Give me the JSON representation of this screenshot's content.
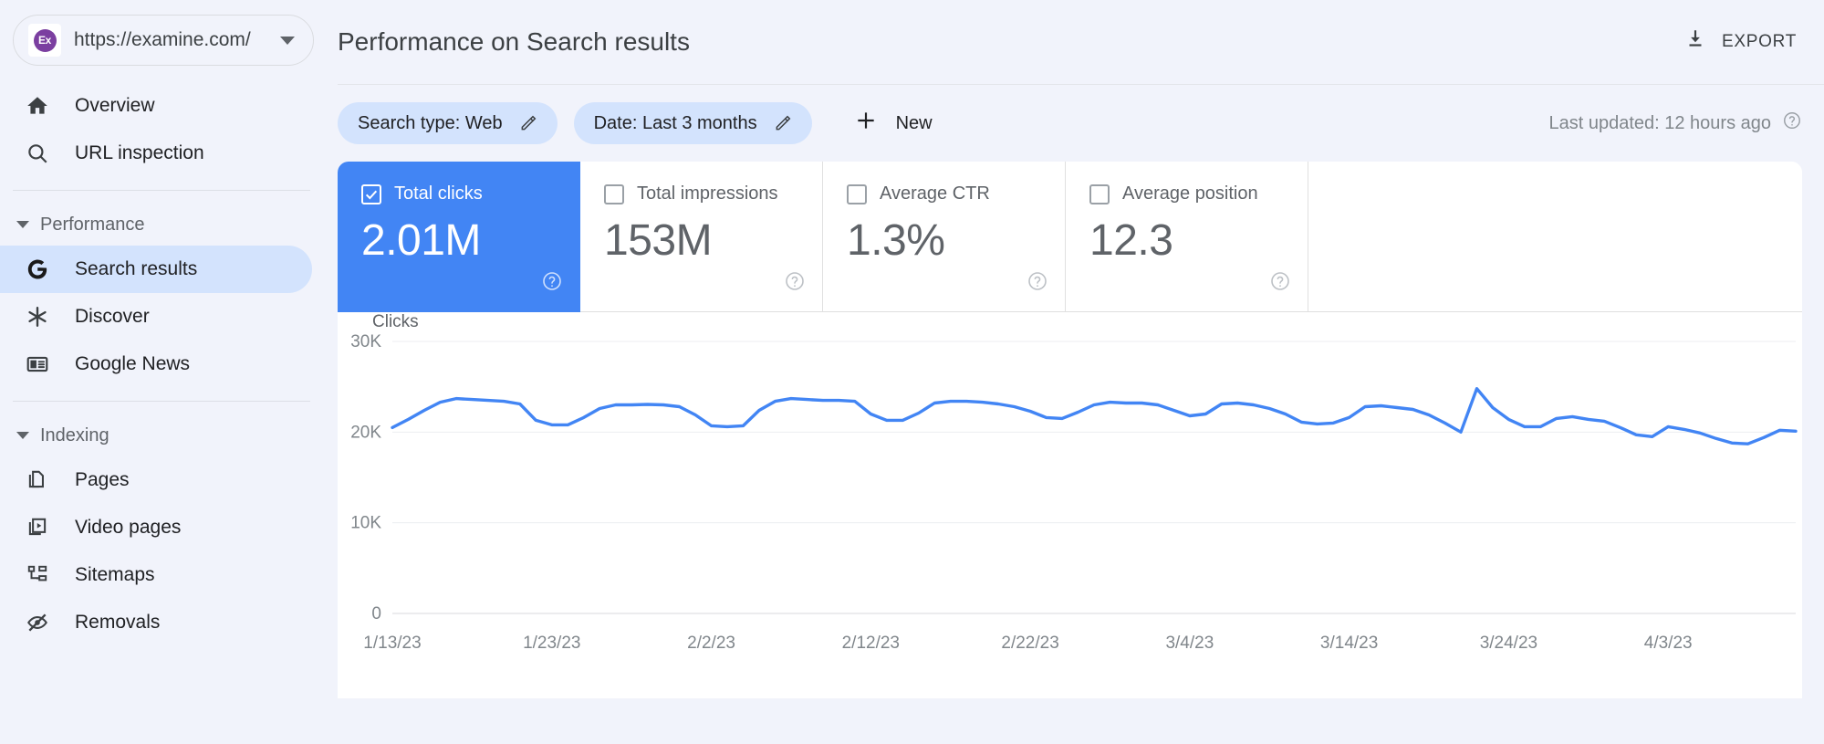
{
  "sidebar": {
    "property": {
      "url": "https://examine.com/",
      "favicon_text": "Ex",
      "favicon_color": "#7b3fa0",
      "caret_icon": "chevron-down-icon"
    },
    "items": [
      {
        "label": "Overview",
        "icon": "home-icon",
        "active": false
      },
      {
        "label": "URL inspection",
        "icon": "search-icon",
        "active": false
      }
    ],
    "sections": [
      {
        "title": "Performance",
        "items": [
          {
            "label": "Search results",
            "icon": "google-g-icon",
            "active": true
          },
          {
            "label": "Discover",
            "icon": "asterisk-icon",
            "active": false
          },
          {
            "label": "Google News",
            "icon": "news-icon",
            "active": false
          }
        ]
      },
      {
        "title": "Indexing",
        "items": [
          {
            "label": "Pages",
            "icon": "pages-icon",
            "active": false
          },
          {
            "label": "Video pages",
            "icon": "video-pages-icon",
            "active": false
          },
          {
            "label": "Sitemaps",
            "icon": "sitemap-icon",
            "active": false
          },
          {
            "label": "Removals",
            "icon": "eye-off-icon",
            "active": false
          }
        ]
      }
    ]
  },
  "header": {
    "title": "Performance on Search results",
    "export_label": "EXPORT",
    "export_icon": "download-icon"
  },
  "filters": {
    "chips": [
      {
        "label": "Search type: Web",
        "icon": "pencil-icon"
      },
      {
        "label": "Date: Last 3 months",
        "icon": "pencil-icon"
      }
    ],
    "new_label": "New",
    "new_icon": "plus-icon",
    "last_updated": "Last updated: 12 hours ago",
    "help_icon": "help-circle-icon"
  },
  "metrics": [
    {
      "label": "Total clicks",
      "value": "2.01M",
      "checked": true,
      "help_icon": "help-circle-icon"
    },
    {
      "label": "Total impressions",
      "value": "153M",
      "checked": false,
      "help_icon": "help-circle-icon"
    },
    {
      "label": "Average CTR",
      "value": "1.3%",
      "checked": false,
      "help_icon": "help-circle-icon"
    },
    {
      "label": "Average position",
      "value": "12.3",
      "checked": false,
      "help_icon": "help-circle-icon"
    }
  ],
  "colors": {
    "accent": "#4285f4",
    "chip_bg": "#d3e3fd",
    "page_bg": "#f1f3fb",
    "line": "#4285f4"
  },
  "chart_data": {
    "type": "line",
    "title": "",
    "ylabel": "Clicks",
    "xlabel": "",
    "ylim": [
      0,
      30000
    ],
    "yticks": [
      0,
      10000,
      20000,
      30000
    ],
    "ytick_labels": [
      "0",
      "10K",
      "20K",
      "30K"
    ],
    "grid": true,
    "legend": "none",
    "series_name": "Total clicks",
    "series_color": "#4285f4",
    "x_tick_labels": [
      "1/13/23",
      "1/23/23",
      "2/2/23",
      "2/12/23",
      "2/22/23",
      "3/4/23",
      "3/14/23",
      "3/24/23",
      "4/3/23"
    ],
    "x_tick_indices": [
      0,
      10,
      20,
      30,
      40,
      50,
      60,
      70,
      80
    ],
    "x_start_date": "1/13/23",
    "x_end_date": "4/8/23",
    "values": [
      20500,
      21400,
      22400,
      23300,
      23700,
      23600,
      23500,
      23400,
      23100,
      21300,
      20800,
      20800,
      21600,
      22600,
      23000,
      23000,
      23050,
      23000,
      22800,
      21900,
      20700,
      20600,
      20700,
      22400,
      23400,
      23700,
      23600,
      23500,
      23500,
      23400,
      22000,
      21300,
      21300,
      22100,
      23200,
      23400,
      23400,
      23300,
      23100,
      22800,
      22300,
      21600,
      21500,
      22200,
      23000,
      23300,
      23200,
      23200,
      23000,
      22400,
      21800,
      22000,
      23100,
      23200,
      23000,
      22600,
      22000,
      21100,
      20900,
      21000,
      21600,
      22800,
      22900,
      22700,
      22500,
      21900,
      21000,
      20000,
      24800,
      22700,
      21400,
      20600,
      20600,
      21500,
      21700,
      21400,
      21200,
      20500,
      19700,
      19500,
      20600,
      20300,
      19900,
      19300,
      18800,
      18700,
      19400,
      20200,
      20100
    ]
  }
}
